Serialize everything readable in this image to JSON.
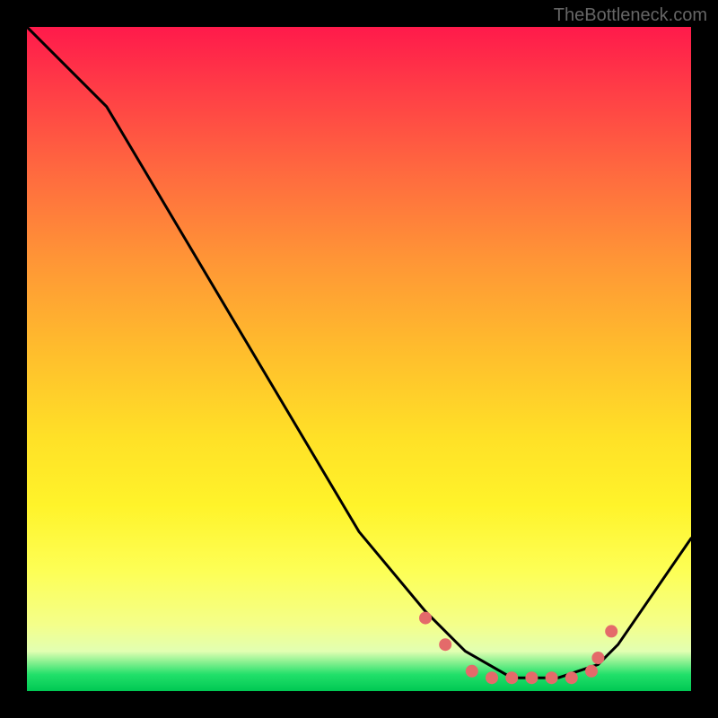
{
  "watermark": "TheBottleneck.com",
  "chart_data": {
    "type": "line",
    "title": "",
    "xlabel": "",
    "ylabel": "",
    "xlim": [
      0,
      100
    ],
    "ylim": [
      0,
      100
    ],
    "series": [
      {
        "name": "curve",
        "x": [
          0,
          6,
          12,
          50,
          60,
          66,
          73,
          80,
          86,
          89,
          100
        ],
        "y": [
          100,
          94,
          88,
          24,
          12,
          6,
          2,
          2,
          4,
          7,
          23
        ]
      }
    ],
    "markers": {
      "name": "dots",
      "color": "#e46a6a",
      "x": [
        60,
        63,
        67,
        70,
        73,
        76,
        79,
        82,
        85,
        86,
        88
      ],
      "y": [
        11,
        7,
        3,
        2,
        2,
        2,
        2,
        2,
        3,
        5,
        9
      ]
    },
    "gradient_stops": [
      {
        "pos": 0.0,
        "color": "#ff1a4b"
      },
      {
        "pos": 0.5,
        "color": "#ffd72a"
      },
      {
        "pos": 0.9,
        "color": "#f0ff8a"
      },
      {
        "pos": 0.975,
        "color": "#22e06a"
      },
      {
        "pos": 1.0,
        "color": "#00c853"
      }
    ]
  }
}
